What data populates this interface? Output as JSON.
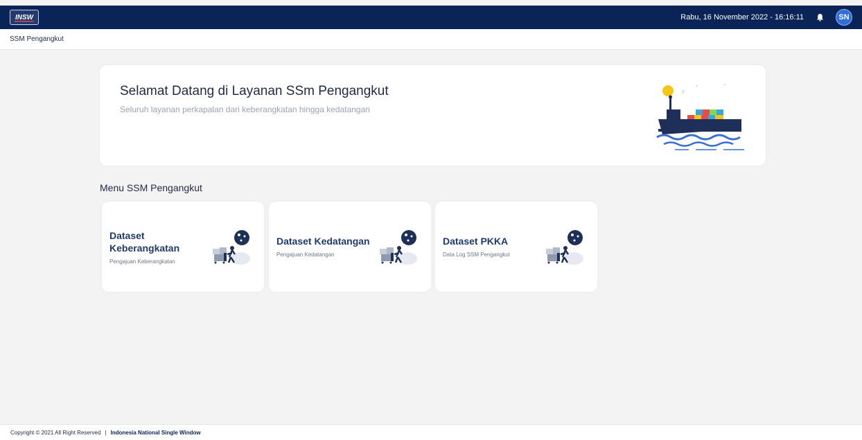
{
  "topbar": {
    "logo_text": "INSW",
    "datetime": "Rabu, 16 November 2022 - 16:16:11",
    "avatar_initials": "SN"
  },
  "breadcrumb": {
    "current": "SSM Pengangkut"
  },
  "hero": {
    "title": "Selamat Datang di Layanan SSm Pengangkut",
    "subtitle": "Seluruh layanan perkapalan dari keberangkatan hingga kedatangan"
  },
  "menu": {
    "title": "Menu SSM Pengangkut",
    "cards": [
      {
        "title": "Dataset Keberangkatan",
        "subtitle": "Pengajuan Keberangkatan"
      },
      {
        "title": "Dataset Kedatangan",
        "subtitle": "Pengajuan Kedatangan"
      },
      {
        "title": "Dataset PKKA",
        "subtitle": "Data Log SSM Pengangkut"
      }
    ]
  },
  "footer": {
    "copyright": "Copyright © 2021 All Right Reserved",
    "separator": "|",
    "brand": "Indonesia National Single Window"
  },
  "colors": {
    "navbar": "#0b2457",
    "accent": "#2e6fd9",
    "background": "#f3f3f4",
    "card_title": "#1e3a6e"
  },
  "icons": [
    "insw-logo-icon",
    "bell-icon",
    "ship-illustration-icon",
    "logistics-illustration-icon"
  ]
}
